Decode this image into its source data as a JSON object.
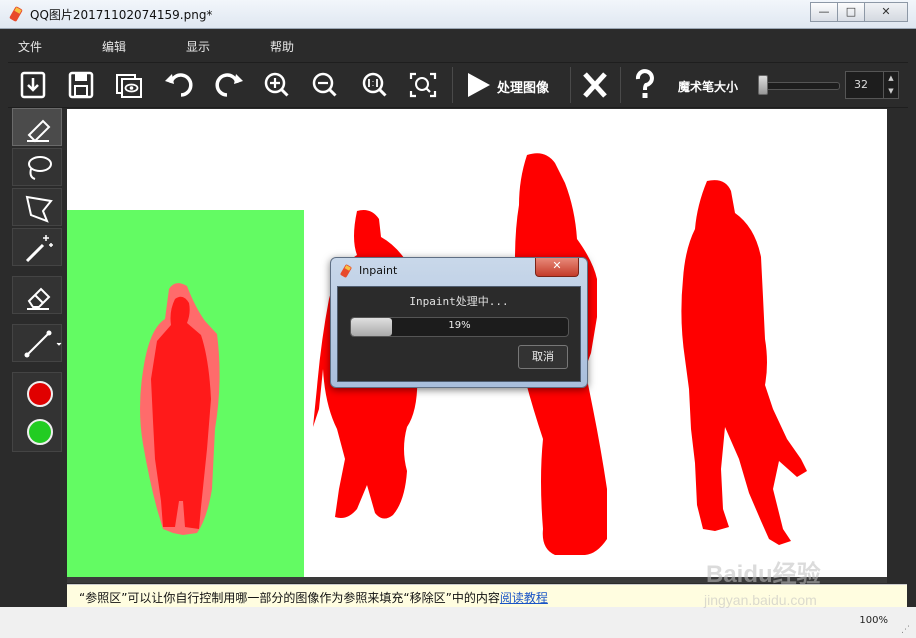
{
  "window": {
    "title": "QQ图片20171102074159.png*",
    "buttons": {
      "minimize": "—",
      "maximize": "□",
      "close": "✕"
    }
  },
  "menu": [
    "文件",
    "编辑",
    "显示",
    "帮助"
  ],
  "toolbar": {
    "icons": [
      "open-icon",
      "save-icon",
      "preview-icon",
      "undo-icon",
      "redo-icon",
      "zoom-in-icon",
      "zoom-out-icon",
      "zoom-actual-icon",
      "zoom-fit-icon",
      "play-icon",
      "clear-icon",
      "help-icon"
    ],
    "process_label": "处理图像",
    "brush_label": "魔术笔大小",
    "brush_size": "32",
    "slider_value": 0.05
  },
  "tools": {
    "items": [
      "brush-icon",
      "lasso-icon",
      "polygon-lasso-icon",
      "magic-wand-icon",
      "eraser-icon",
      "line-icon"
    ],
    "colors": {
      "remove": "#e00000",
      "reference": "#22cc22"
    }
  },
  "canvas": {
    "reference_color": "#63fb63",
    "mask_color": "#ff0000"
  },
  "dialog": {
    "title": "Inpaint",
    "message": "Inpaint处理中...",
    "progress_text": "19%",
    "progress_value": 0.19,
    "close": "✕",
    "cancel": "取消"
  },
  "hint": {
    "text": "“参照区”可以让你自行控制用哪一部分的图像作为参照来填充“移除区”中的内容",
    "link": "阅读教程"
  },
  "status": {
    "zoom": "100%"
  },
  "watermark": {
    "main": "Baidu经验",
    "sub": "jingyan.baidu.com"
  }
}
